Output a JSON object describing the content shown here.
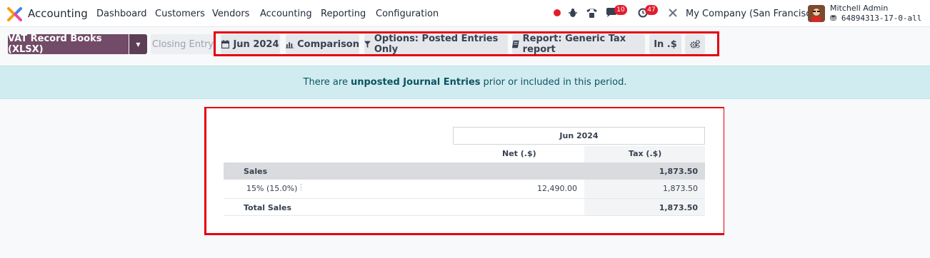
{
  "app": {
    "name": "Accounting",
    "menus": [
      "Dashboard",
      "Customers",
      "Vendors",
      "Accounting",
      "Reporting",
      "Configuration"
    ]
  },
  "systray": {
    "messages_count": "10",
    "activities_count": "47",
    "company": "My Company (San Francisco)",
    "user_name": "Mitchell Admin",
    "database": "64894313-17-0-all"
  },
  "toolbar": {
    "primary_button": "VAT Record Books (XLSX)",
    "closing_entry": "Closing Entry",
    "filters": {
      "date": "Jun 2024",
      "comparison": "Comparison",
      "options": "Options: Posted Entries Only",
      "report": "Report: Generic Tax report",
      "currency": "In .$"
    }
  },
  "alert": {
    "prefix": "There are",
    "link": "unposted Journal Entries",
    "suffix": "prior or included in this period."
  },
  "report": {
    "period_header": "Jun 2024",
    "columns": [
      "Net (.$)",
      "Tax (.$)"
    ],
    "rows": [
      {
        "label": "Sales",
        "net": "",
        "tax": "1,873.50"
      },
      {
        "label": "15% (15.0%)",
        "net": "12,490.00",
        "tax": "1,873.50"
      },
      {
        "label": "Total Sales",
        "net": "",
        "tax": "1,873.50"
      }
    ]
  },
  "colors": {
    "brand": "#714b67",
    "alert_bg": "#d1ecf1",
    "highlight": "#e3000f",
    "badge": "#e11d2e"
  }
}
